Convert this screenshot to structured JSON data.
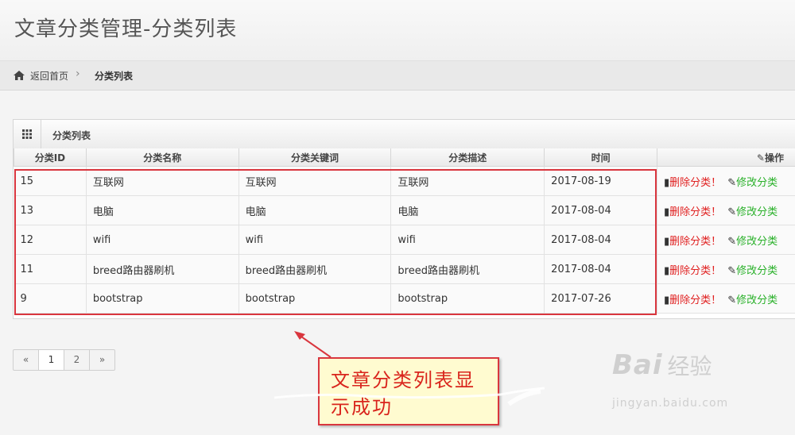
{
  "page": {
    "title": "文章分类管理-分类列表"
  },
  "breadcrumb": {
    "home": "返回首页",
    "separator": "›",
    "current": "分类列表"
  },
  "widget": {
    "title": "分类列表"
  },
  "table": {
    "columns": [
      "分类ID",
      "分类名称",
      "分类关键词",
      "分类描述",
      "时间",
      "操作"
    ],
    "rows": [
      {
        "id": "15",
        "name": "互联网",
        "keywords": "互联网",
        "desc": "互联网",
        "date": "2017-08-19"
      },
      {
        "id": "13",
        "name": "电脑",
        "keywords": "电脑",
        "desc": "电脑",
        "date": "2017-08-04"
      },
      {
        "id": "12",
        "name": "wifi",
        "keywords": "wifi",
        "desc": "wifi",
        "date": "2017-08-04"
      },
      {
        "id": "11",
        "name": "breed路由器刷机",
        "keywords": "breed路由器刷机",
        "desc": "breed路由器刷机",
        "date": "2017-08-04"
      },
      {
        "id": "9",
        "name": "bootstrap",
        "keywords": "bootstrap",
        "desc": "bootstrap",
        "date": "2017-07-26"
      }
    ],
    "actions": {
      "delete": "删除分类！",
      "edit": "修改分类"
    }
  },
  "pagination": {
    "prev": "«",
    "pages": [
      "1",
      "2"
    ],
    "next": "»",
    "active": "2"
  },
  "callout": {
    "text": "文章分类列表显示成功"
  },
  "watermark": {
    "brand": "Bai",
    "cn": "经验",
    "url": "jingyan.baidu.com"
  },
  "colors": {
    "highlight": "#d9363e",
    "delete": "#e02020",
    "edit": "#28b028",
    "callout_bg": "#fffbd0"
  },
  "icons": {
    "home": "home-icon",
    "grid": "grid-icon",
    "trash": "trash-icon",
    "edit": "edit-icon",
    "pencil": "pencil-icon"
  }
}
